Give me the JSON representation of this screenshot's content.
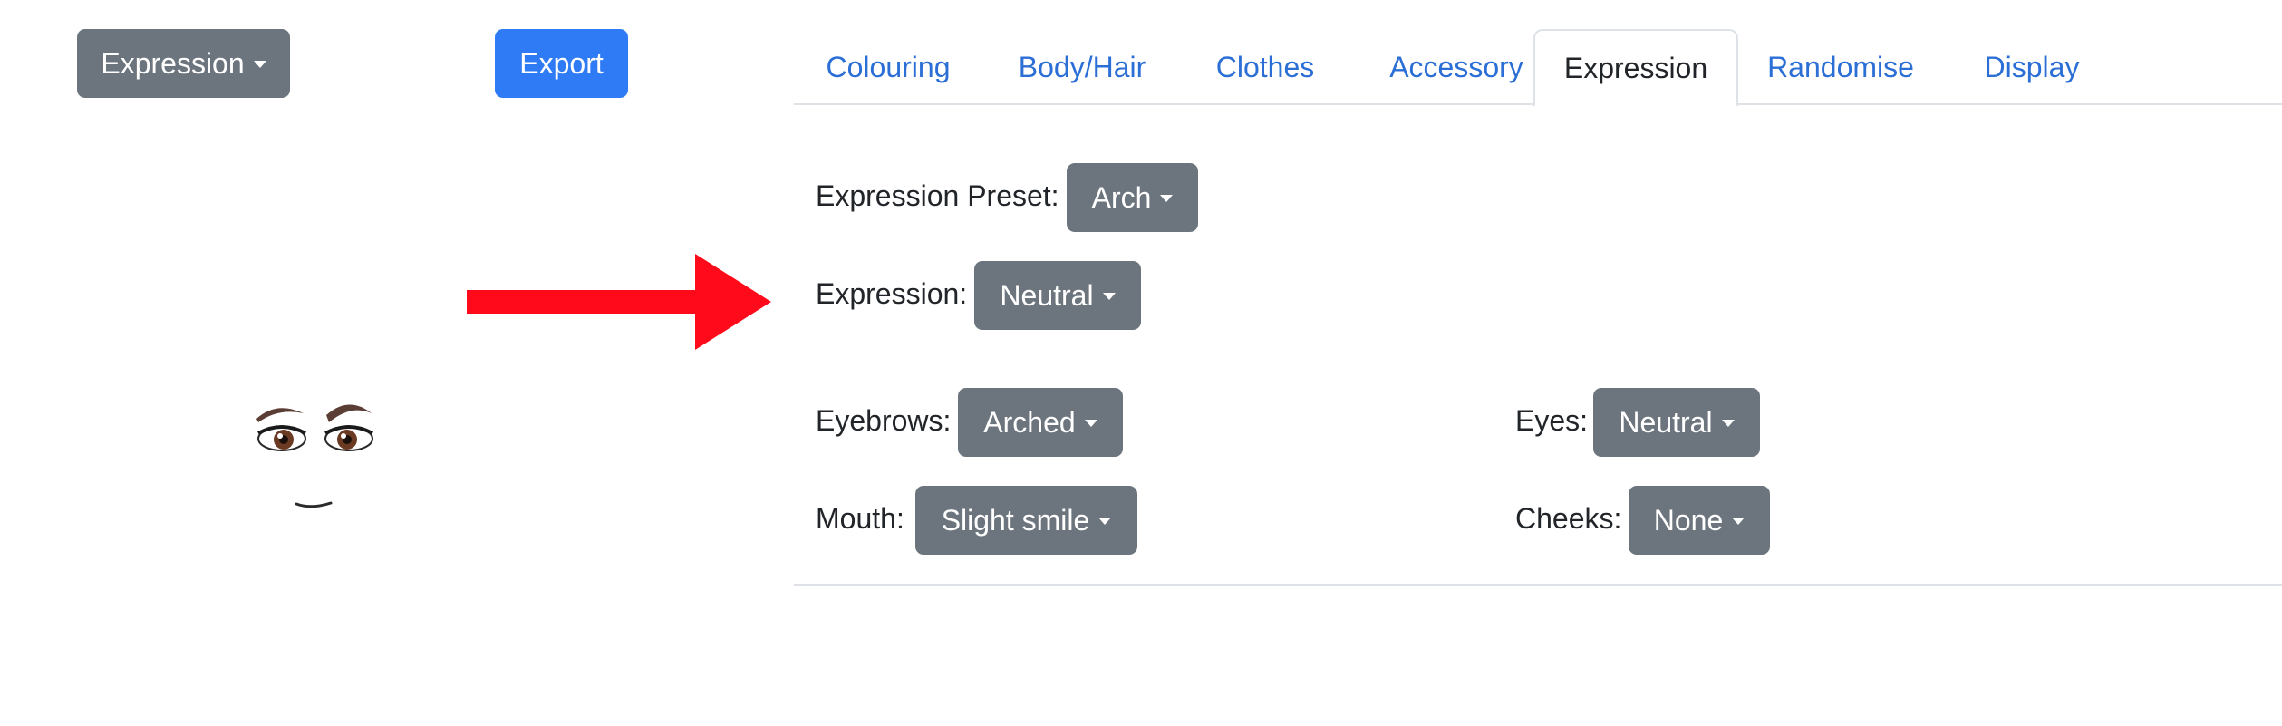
{
  "left_panel": {
    "view_dropdown_label": "Expression",
    "export_label": "Export",
    "arrow_color": "#ff0a1a"
  },
  "tabs": [
    {
      "label": "Colouring",
      "active": false
    },
    {
      "label": "Body/Hair",
      "active": false
    },
    {
      "label": "Clothes",
      "active": false
    },
    {
      "label": "Accessory",
      "active": false
    },
    {
      "label": "Expression",
      "active": true
    },
    {
      "label": "Randomise",
      "active": false
    },
    {
      "label": "Display",
      "active": false
    }
  ],
  "expression": {
    "preset": {
      "label": "Expression Preset:",
      "value": "Arch"
    },
    "expression": {
      "label": "Expression:",
      "value": "Neutral"
    },
    "eyebrows": {
      "label": "Eyebrows:",
      "value": "Arched"
    },
    "eyes": {
      "label": "Eyes:",
      "value": "Neutral"
    },
    "mouth": {
      "label": "Mouth:",
      "value": "Slight smile"
    },
    "cheeks": {
      "label": "Cheeks:",
      "value": "None"
    }
  },
  "colors": {
    "secondary": "#6c757d",
    "primary": "#2f7bf5",
    "link": "#2b6fd6"
  }
}
